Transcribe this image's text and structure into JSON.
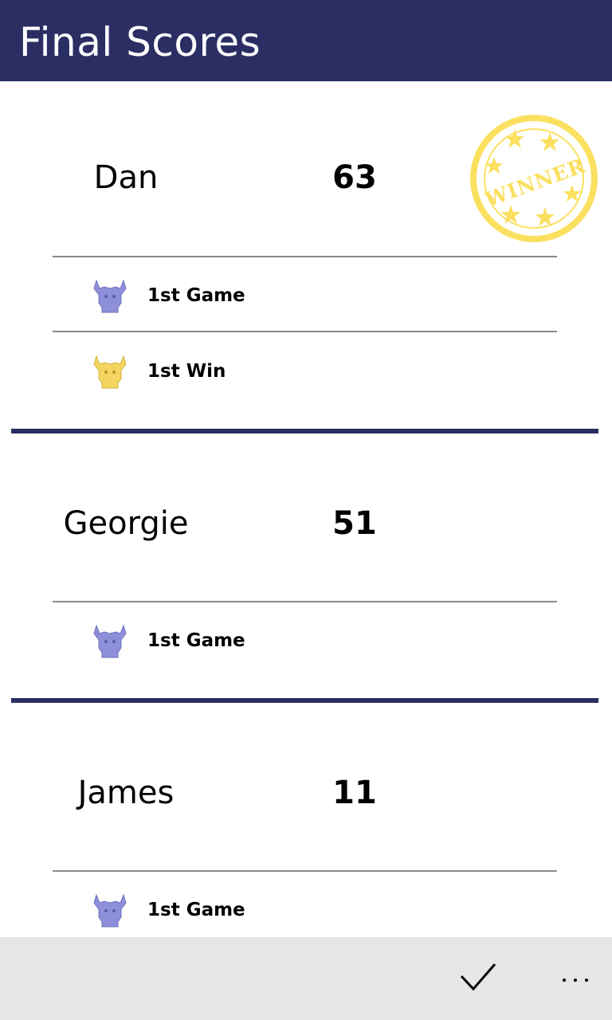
{
  "header": {
    "title": "Final Scores",
    "background": "#2a2e63"
  },
  "players": [
    {
      "name": "Dan",
      "score": "63",
      "winner": true,
      "stamp_text": "WINNER",
      "achievements": [
        {
          "label": "1st Game",
          "icon": "purple-bull-icon",
          "color": "#8d8fd9"
        },
        {
          "label": "1st Win",
          "icon": "gold-bull-icon",
          "color": "#f3d560"
        }
      ]
    },
    {
      "name": "Georgie",
      "score": "51",
      "winner": false,
      "achievements": [
        {
          "label": "1st Game",
          "icon": "purple-bull-icon",
          "color": "#8d8fd9"
        }
      ]
    },
    {
      "name": "James",
      "score": "11",
      "winner": false,
      "achievements": [
        {
          "label": "1st Game",
          "icon": "purple-bull-icon",
          "color": "#8d8fd9"
        }
      ]
    }
  ],
  "appbar": {
    "confirm_icon": "checkmark-icon",
    "more_icon": "more-options-icon"
  },
  "colors": {
    "accent": "#2a2e63",
    "stamp": "#fbe060",
    "appbar": "#e6e6e6"
  }
}
